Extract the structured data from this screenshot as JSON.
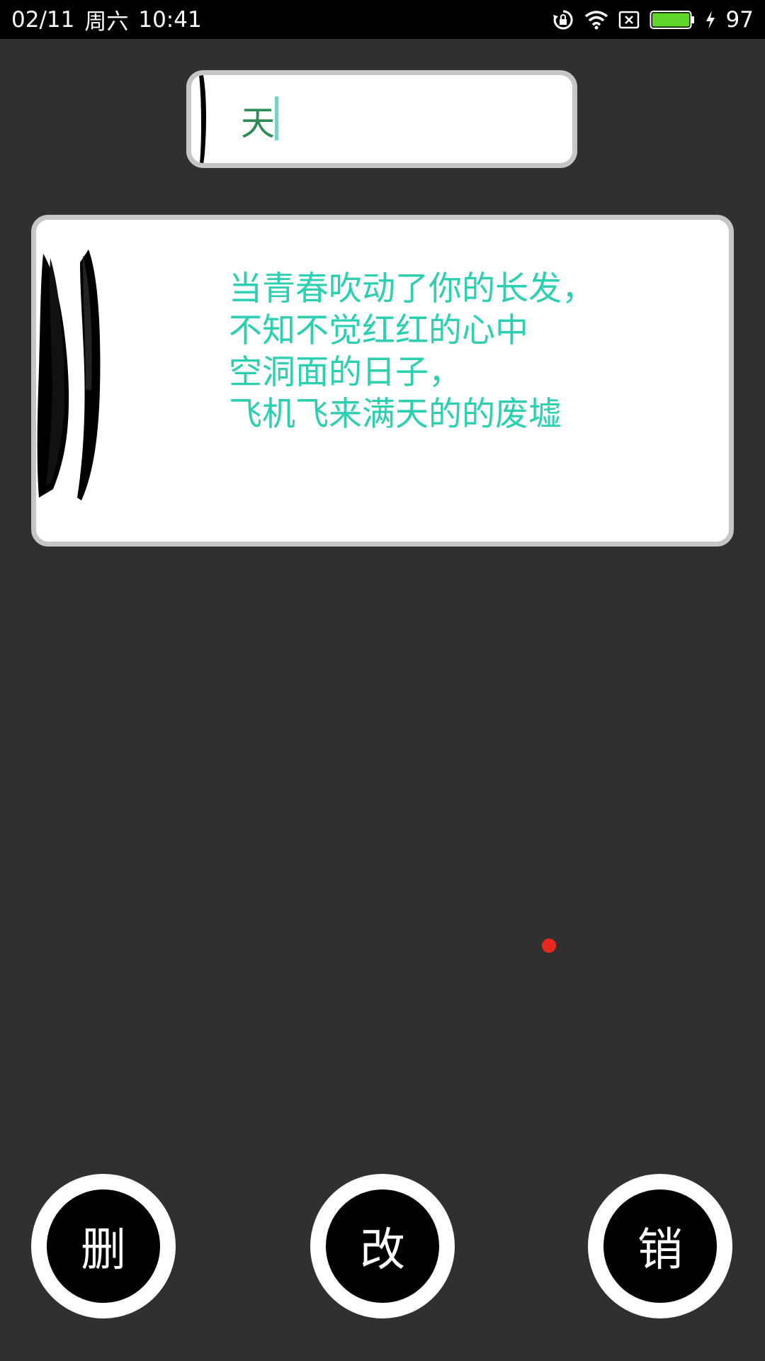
{
  "status_bar": {
    "date": "02/11",
    "weekday": "周六",
    "time": "10:41",
    "battery_level": "97",
    "icons": [
      "rotation-lock-icon",
      "wifi-icon",
      "no-sim-icon",
      "battery-icon",
      "charging-icon"
    ],
    "battery_color": "#5fd52a"
  },
  "search": {
    "value": "天"
  },
  "poem_card": {
    "lines": [
      "当青春吹动了你的长发，",
      "不知不觉红红的心中",
      "空洞面的日子，",
      "飞机飞来满天的的废墟"
    ],
    "text_color": "#2ccfb0"
  },
  "actions": {
    "delete_label": "删",
    "edit_label": "改",
    "undo_label": "销"
  },
  "colors": {
    "background": "#303030",
    "marker": "#e8281e"
  }
}
